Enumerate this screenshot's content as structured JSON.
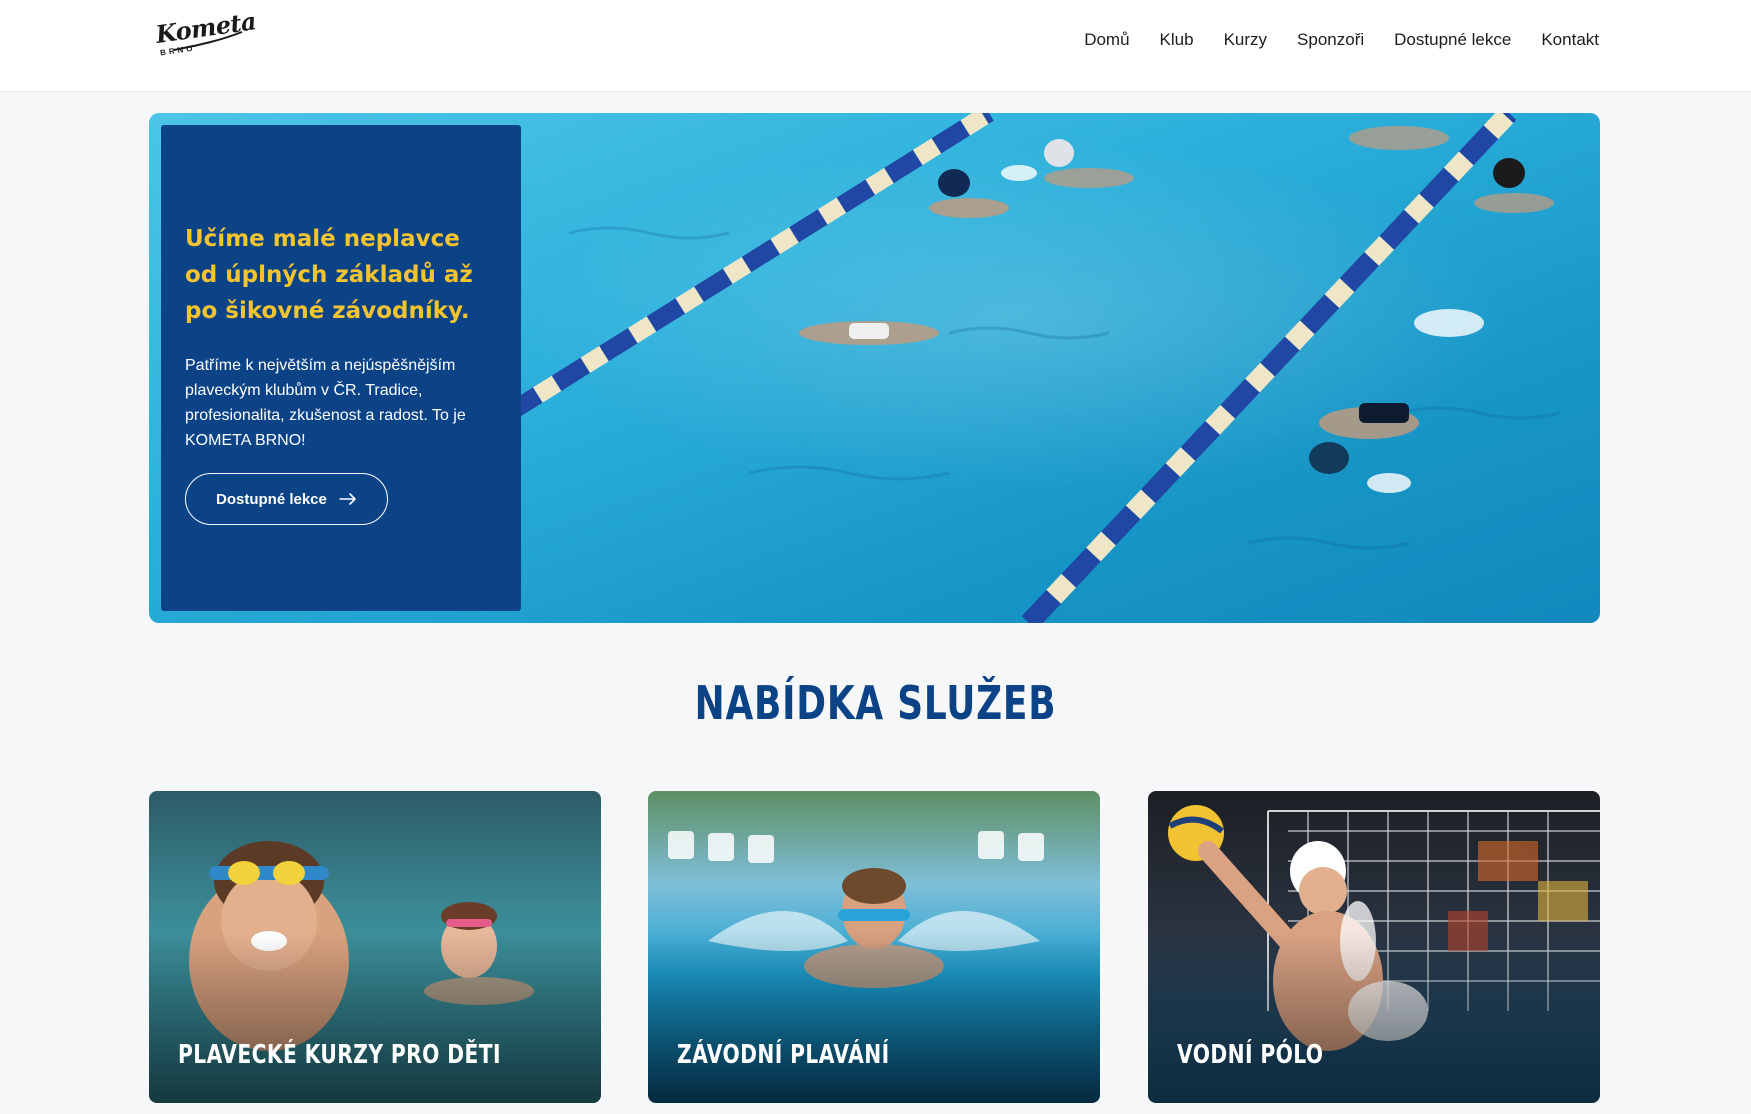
{
  "header": {
    "logo_text": "Kometa",
    "logo_sub": "BRNO",
    "nav": [
      {
        "label": "Domů"
      },
      {
        "label": "Klub"
      },
      {
        "label": "Kurzy"
      },
      {
        "label": "Sponzoři"
      },
      {
        "label": "Dostupné lekce"
      },
      {
        "label": "Kontakt"
      }
    ]
  },
  "hero": {
    "title": "Učíme malé neplavce od úplných základů až po šikovné závodníky.",
    "text": "Patříme k největším a nejúspěšnějším plaveckým klubům v ČR. Tradice, profesionalita, zkušenost a radost. To je KOMETA BRNO!",
    "button_label": "Dostupné lekce",
    "image": "swimming-pool-lanes-photo"
  },
  "services": {
    "title": "NABÍDKA SLUŽEB",
    "cards": [
      {
        "label": "PLAVECKÉ KURZY PRO DĚTI",
        "image": "kids-with-goggles-photo"
      },
      {
        "label": "ZÁVODNÍ PLAVÁNÍ",
        "image": "butterfly-swimmer-photo"
      },
      {
        "label": "VODNÍ PÓLO",
        "image": "water-polo-player-photo"
      }
    ]
  },
  "colors": {
    "brand_blue": "#0b4386",
    "accent_yellow": "#f4c430",
    "background": "#f6f7f8"
  }
}
